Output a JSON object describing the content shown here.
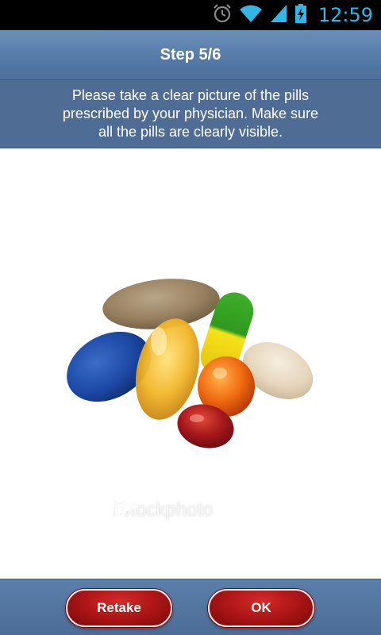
{
  "status_bar": {
    "time": "12:59",
    "icons": [
      "alarm-icon",
      "wifi-icon",
      "signal-icon",
      "battery-charging-icon"
    ],
    "accent_color": "#33b5e5"
  },
  "header": {
    "title": "Step 5/6"
  },
  "instructions": {
    "text": "Please take a clear picture of the pills prescribed by your physician. Make sure all the pills are clearly visible."
  },
  "photo": {
    "watermark": "iStockphoto"
  },
  "actions": {
    "retake_label": "Retake",
    "ok_label": "OK",
    "button_color": "#b01818"
  }
}
